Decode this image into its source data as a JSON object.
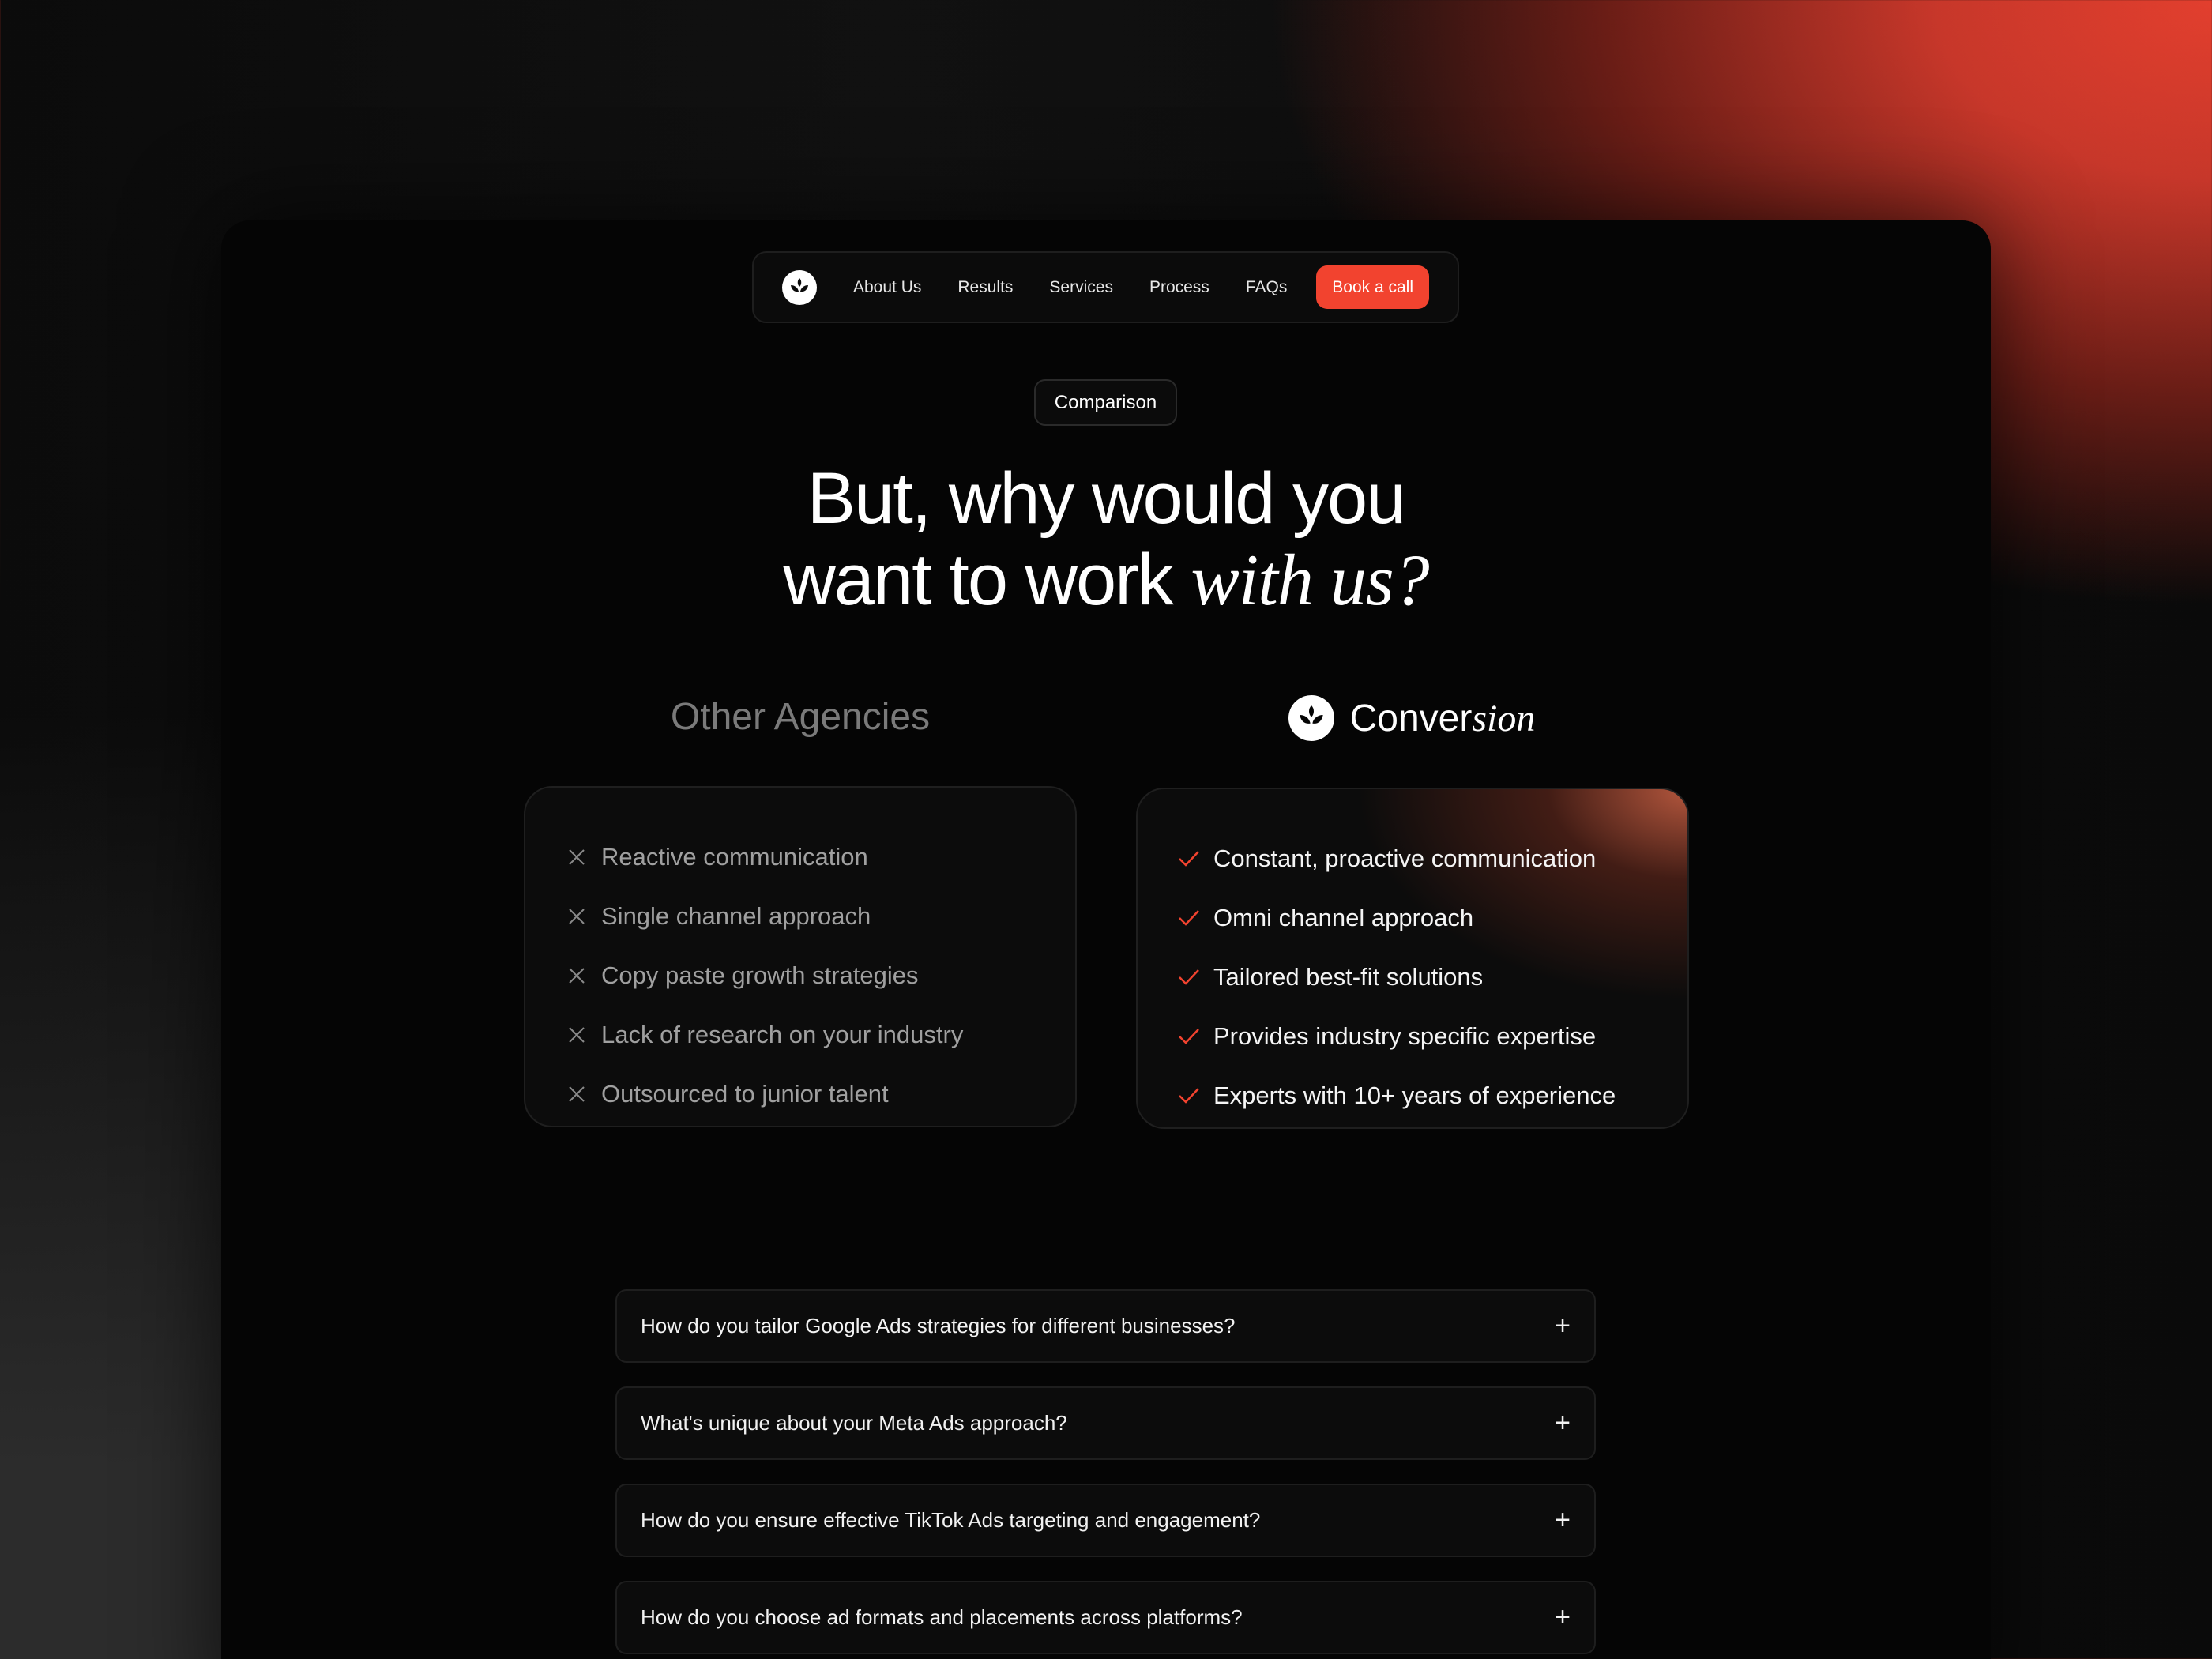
{
  "nav": {
    "links": [
      "About Us",
      "Results",
      "Services",
      "Process",
      "FAQs"
    ],
    "cta": "Book a call"
  },
  "section_badge": "Comparison",
  "headline": {
    "line1": "But, why would you",
    "line2_plain": "want to work ",
    "line2_italic": "with us?"
  },
  "comparison": {
    "other_title": "Other Agencies",
    "brand": {
      "plain": "Conver",
      "italic": "sion"
    },
    "other_items": [
      "Reactive communication",
      "Single channel approach",
      "Copy paste growth strategies",
      "Lack of research on your industry",
      "Outsourced to junior talent"
    ],
    "our_items": [
      "Constant, proactive communication",
      "Omni channel approach",
      "Tailored best-fit solutions",
      "Provides industry specific expertise",
      "Experts with 10+ years of experience"
    ]
  },
  "faqs": [
    "How do you tailor Google Ads strategies for different businesses?",
    "What's unique about your Meta Ads approach?",
    "How do you ensure effective TikTok Ads targeting and engagement?",
    "How do you choose ad formats and placements across platforms?"
  ],
  "colors": {
    "accent": "#f2432f",
    "background": "#050505"
  }
}
